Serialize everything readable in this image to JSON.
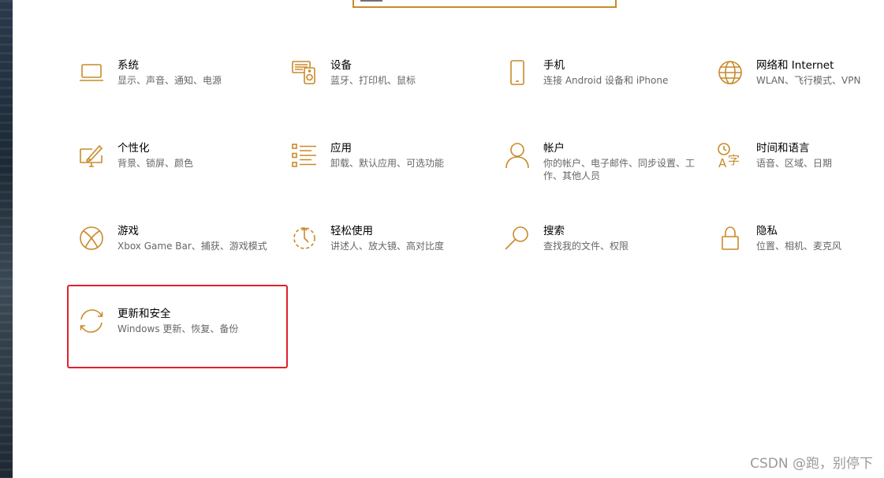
{
  "colors": {
    "accent": "#c98a2a",
    "highlight": "#e0202a",
    "title": "#000000",
    "desc": "#666666"
  },
  "tiles": [
    {
      "title": "系统",
      "desc": "显示、声音、通知、电源",
      "icon": "laptop-icon"
    },
    {
      "title": "设备",
      "desc": "蓝牙、打印机、鼠标",
      "icon": "devices-icon"
    },
    {
      "title": "手机",
      "desc": "连接 Android 设备和 iPhone",
      "icon": "phone-icon"
    },
    {
      "title": "网络和 Internet",
      "desc": "WLAN、飞行模式、VPN",
      "icon": "globe-icon"
    },
    {
      "title": "个性化",
      "desc": "背景、锁屏、颜色",
      "icon": "personalization-icon"
    },
    {
      "title": "应用",
      "desc": "卸载、默认应用、可选功能",
      "icon": "apps-list-icon"
    },
    {
      "title": "帐户",
      "desc": "你的帐户、电子邮件、同步设置、工作、其他人员",
      "icon": "person-icon"
    },
    {
      "title": "时间和语言",
      "desc": "语音、区域、日期",
      "icon": "time-language-icon"
    },
    {
      "title": "游戏",
      "desc": "Xbox Game Bar、捕获、游戏模式",
      "icon": "xbox-icon"
    },
    {
      "title": "轻松使用",
      "desc": "讲述人、放大镜、高对比度",
      "icon": "ease-of-access-icon"
    },
    {
      "title": "搜索",
      "desc": "查找我的文件、权限",
      "icon": "search-icon"
    },
    {
      "title": "隐私",
      "desc": "位置、相机、麦克风",
      "icon": "lock-icon"
    },
    {
      "title": "更新和安全",
      "desc": "Windows 更新、恢复、备份",
      "icon": "sync-icon"
    }
  ],
  "watermark": "CSDN @跑，别停下"
}
